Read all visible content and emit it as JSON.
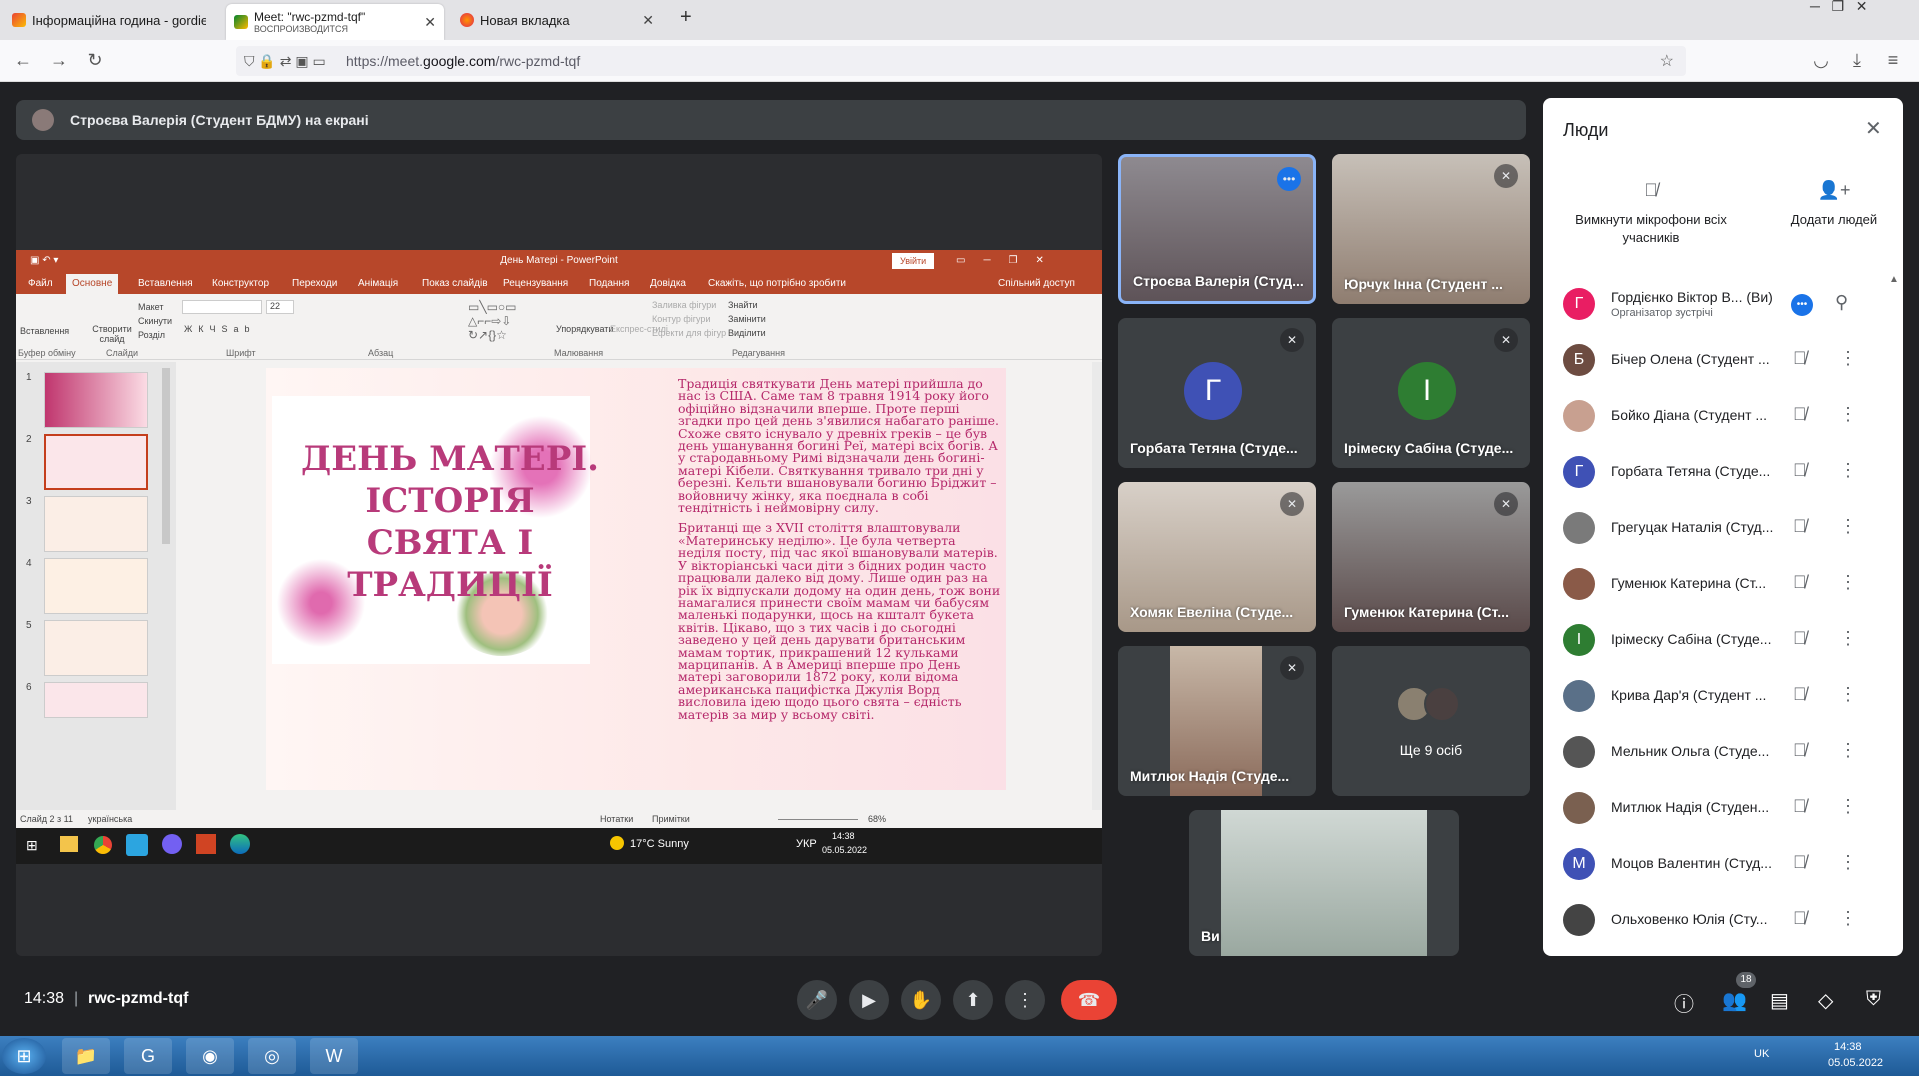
{
  "browser": {
    "tabs": [
      {
        "title": "Інформаційна година - gordienko",
        "active": false
      },
      {
        "title": "Meet: \"rwc-pzmd-tqf\"",
        "subtitle": "ВОСПРОИЗВОДИТСЯ",
        "active": true
      },
      {
        "title": "Новая вкладка",
        "active": false
      }
    ],
    "new_tab": "+",
    "url_prefix": "https://meet.",
    "url_domain": "google.com",
    "url_path": "/rwc-pzmd-tqf"
  },
  "meet": {
    "presenter_banner": "Строєва Валерія (Студент БДМУ) на екрані",
    "tiles": [
      {
        "name": "Строєва Валерія (Студ...",
        "kind": "video",
        "highlight": true
      },
      {
        "name": "Юрчук Інна (Студент ...",
        "kind": "video"
      },
      {
        "name": "Горбата Тетяна (Студе...",
        "kind": "avatar",
        "letter": "Г",
        "color": "#3f51b5"
      },
      {
        "name": "Ірімеску Сабіна (Студе...",
        "kind": "avatar",
        "letter": "І",
        "color": "#2e7d32"
      },
      {
        "name": "Хомяк Евеліна (Студе...",
        "kind": "video"
      },
      {
        "name": "Гуменюк Катерина (Ст...",
        "kind": "video"
      },
      {
        "name": "Митлюк Надія (Студе...",
        "kind": "video"
      },
      {
        "name": "Ще 9 осіб",
        "kind": "more"
      }
    ],
    "self_tile": {
      "name": "Ви"
    },
    "bottom": {
      "time": "14:38",
      "separator": "|",
      "meeting_code": "rwc-pzmd-tqf",
      "people_count": "18"
    }
  },
  "people_panel": {
    "title": "Люди",
    "mute_all": "Вимкнути мікрофони всіх учасників",
    "add_people": "Додати людей",
    "participants": [
      {
        "name": "Гордієнко Віктор В... (Ви)",
        "sub": "Організатор зустрічі",
        "letter": "Г",
        "color": "#e91e63"
      },
      {
        "name": "Бічер Олена (Студент ...",
        "letter": "Б",
        "color": "#6d4c41"
      },
      {
        "name": "Бойко Діана (Студент ...",
        "letter": "",
        "color": "#c8a090"
      },
      {
        "name": "Горбата Тетяна (Студе...",
        "letter": "Г",
        "color": "#3f51b5"
      },
      {
        "name": "Грегуцак Наталія (Студ...",
        "letter": "",
        "color": "#7a7a7a"
      },
      {
        "name": "Гуменюк Катерина (Ст...",
        "letter": "",
        "color": "#8a5a48"
      },
      {
        "name": "Ірімеску Сабіна (Студе...",
        "letter": "І",
        "color": "#2e7d32"
      },
      {
        "name": "Крива Дар'я (Студент ...",
        "letter": "",
        "color": "#5a7088"
      },
      {
        "name": "Мельник Ольга (Студе...",
        "letter": "",
        "color": "#555"
      },
      {
        "name": "Митлюк Надія (Студен...",
        "letter": "",
        "color": "#7a6050"
      },
      {
        "name": "Моцов Валентин (Студ...",
        "letter": "М",
        "color": "#3f51b5"
      },
      {
        "name": "Ольховенко Юлія (Сту...",
        "letter": "",
        "color": "#444"
      }
    ]
  },
  "powerpoint": {
    "window_title": "День Матері  -  PowerPoint",
    "signin": "Увійти",
    "menu": [
      "Файл",
      "Основне",
      "Вставлення",
      "Конструктор",
      "Переходи",
      "Анімація",
      "Показ слайдів",
      "Рецензування",
      "Подання",
      "Довідка",
      "Скажіть, що потрібно зробити",
      "Спільний доступ"
    ],
    "ribbon_groups": [
      "Буфер обміну",
      "Слайди",
      "Шрифт",
      "Абзац",
      "Малювання",
      "Редагування"
    ],
    "ribbon_items": {
      "paste": "Вставлення",
      "new_slide": "Створити слайд",
      "layout": "Макет",
      "reset": "Скинути",
      "section": "Розділ",
      "font_size": "22",
      "arrange": "Упорядкувати",
      "styles": "Експрес-стилі",
      "find": "Знайти",
      "replace": "Замінити",
      "select": "Виділити",
      "fill": "Заливка фігури",
      "outline": "Контур фігури",
      "effects": "Ефекти для фігур"
    },
    "slide_numbers": [
      "1",
      "2",
      "3",
      "4",
      "5",
      "6"
    ],
    "slide_title": "ДЕНЬ МАТЕРІ. ІСТОРІЯ СВЯТА І ТРАДИЦІЇ",
    "slide_para1": "Традиція святкувати День матері прийшла до нас із США. Саме там 8 травня 1914 року його офіційно відзначили вперше. Проте перші згадки про цей день з'явилися набагато раніше. Схоже свято існувало у древніх греків – це був день ушанування богині Реї, матері всіх богів. А у стародавньому Римі відзначали день богині-матері Кібели. Святкування тривало три дні у березні. Кельти вшановували богиню Бріджит – войовничу жінку, яка поєднала в собі тендітність і неймовірну силу.",
    "slide_para2": "Британці ще з XVII століття влаштовували «Материнську неділю». Це була четверта неділя посту, під час якої вшановували матерів. У вікторіанські часи діти з бідних родин часто працювали далеко від дому. Лише один раз на рік їх відпускали додому на один день, тож вони намагалися принести своїм мамам чи бабусям маленькі подарунки, щось на кшталт букета квітів. Цікаво, що з тих часів і до сьогодні заведено у цей день дарувати британським мамам тортик, прикрашений 12 кульками марципанів. А в Америці вперше про День матері заговорили 1872 року, коли відома американська пацифістка Джулія Ворд висловила ідею щодо цього свята – єдність матерів за мир у всьому світі.",
    "status_left": "Слайд 2 з 11",
    "status_lang": "українська",
    "notes": "Нотатки",
    "comments": "Примітки",
    "zoom": "68%",
    "taskbar_weather": "17°C  Sunny",
    "taskbar_lang": "УКР",
    "taskbar_time": "14:38",
    "taskbar_date": "05.05.2022"
  },
  "taskbar": {
    "lang": "UK",
    "time": "14:38",
    "date": "05.05.2022"
  }
}
